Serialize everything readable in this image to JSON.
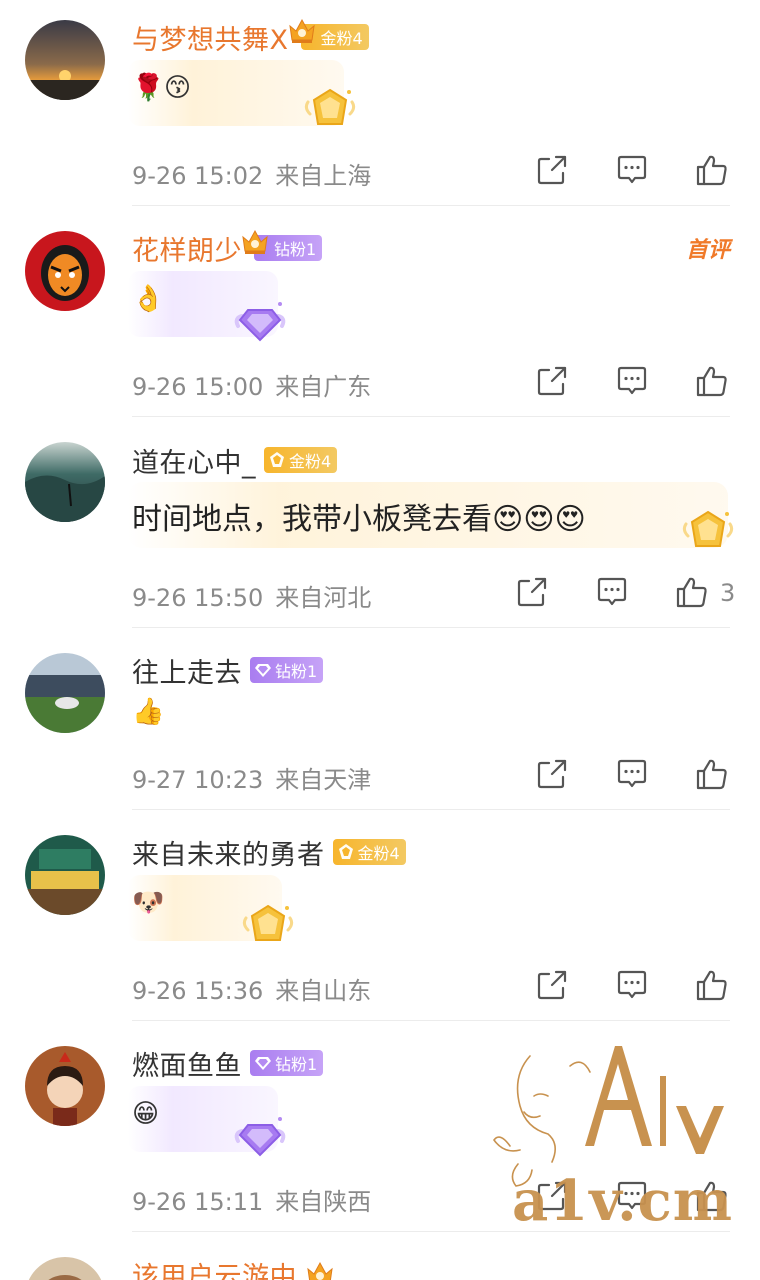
{
  "comments": [
    {
      "username": "与梦想共舞X",
      "badge": "金粉4",
      "emojis": [
        "🌹",
        "😙"
      ],
      "time": "9-26 15:02",
      "location": "来自上海",
      "likes": ""
    },
    {
      "username": "花样朗少",
      "badge": "钻粉1",
      "first_label": "首评",
      "emojis": [
        "👌"
      ],
      "time": "9-26 15:00",
      "location": "来自广东",
      "likes": ""
    },
    {
      "username": "道在心中_",
      "badge": "金粉4",
      "text": "时间地点，我带小板凳去看😍😍😍",
      "time": "9-26 15:50",
      "location": "来自河北",
      "likes": "3"
    },
    {
      "username": "往上走去",
      "badge": "钻粉1",
      "emojis": [
        "👍"
      ],
      "time": "9-27 10:23",
      "location": "来自天津",
      "likes": ""
    },
    {
      "username": "来自未来的勇者",
      "badge": "金粉4",
      "emojis": [
        "🐶"
      ],
      "time": "9-26 15:36",
      "location": "来自山东",
      "likes": ""
    },
    {
      "username": "燃面鱼鱼",
      "badge": "钻粉1",
      "emojis": [
        "😁"
      ],
      "time": "9-26 15:11",
      "location": "来自陕西",
      "likes": ""
    },
    {
      "username": "该用户云游中"
    }
  ],
  "watermark": {
    "text": "a1v.cm",
    "logo_text": "A1v"
  },
  "icons": [
    "share-icon",
    "comment-icon",
    "like-icon",
    "gold-fan-badge-icon",
    "diamond-fan-badge-icon"
  ],
  "colors": {
    "vip_name": "#e8772e",
    "meta_gray": "#8a8a8a",
    "gold_badge": "#f7b52c",
    "diamond_badge": "#a97df0",
    "first_comment": "#f07a2a",
    "watermark": "#c8924f"
  }
}
